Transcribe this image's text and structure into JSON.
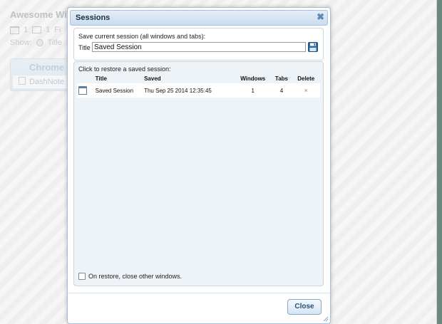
{
  "background": {
    "app_title": "Awesome Win",
    "windows_count": "1",
    "tabs_count": "1",
    "filter_label": "Fi",
    "show_label": "Show:",
    "show_option": "Title",
    "window_title": "Chrome",
    "tab_title": "DashNote"
  },
  "dialog": {
    "title": "Sessions",
    "save_section": {
      "hint": "Save current session (all windows and tabs):",
      "title_label": "Title",
      "title_value": "Saved Session",
      "save_icon": "floppy-disk-icon"
    },
    "restore_section": {
      "hint": "Click to restore a saved session:",
      "columns": {
        "title": "Title",
        "saved": "Saved",
        "windows": "Windows",
        "tabs": "Tabs",
        "delete": "Delete"
      },
      "rows": [
        {
          "title": "Saved Session",
          "saved": "Thu Sep 25 2014 12:35:45",
          "windows": "1",
          "tabs": "4",
          "delete": "×"
        }
      ],
      "close_others_label": "On restore, close other windows.",
      "close_others_checked": false
    },
    "close_button": "Close",
    "close_x": "✖"
  },
  "colors": {
    "accent": "#5b8ab5",
    "titlebar_text": "#1c2e42",
    "desktop": "#6b8a7d"
  }
}
